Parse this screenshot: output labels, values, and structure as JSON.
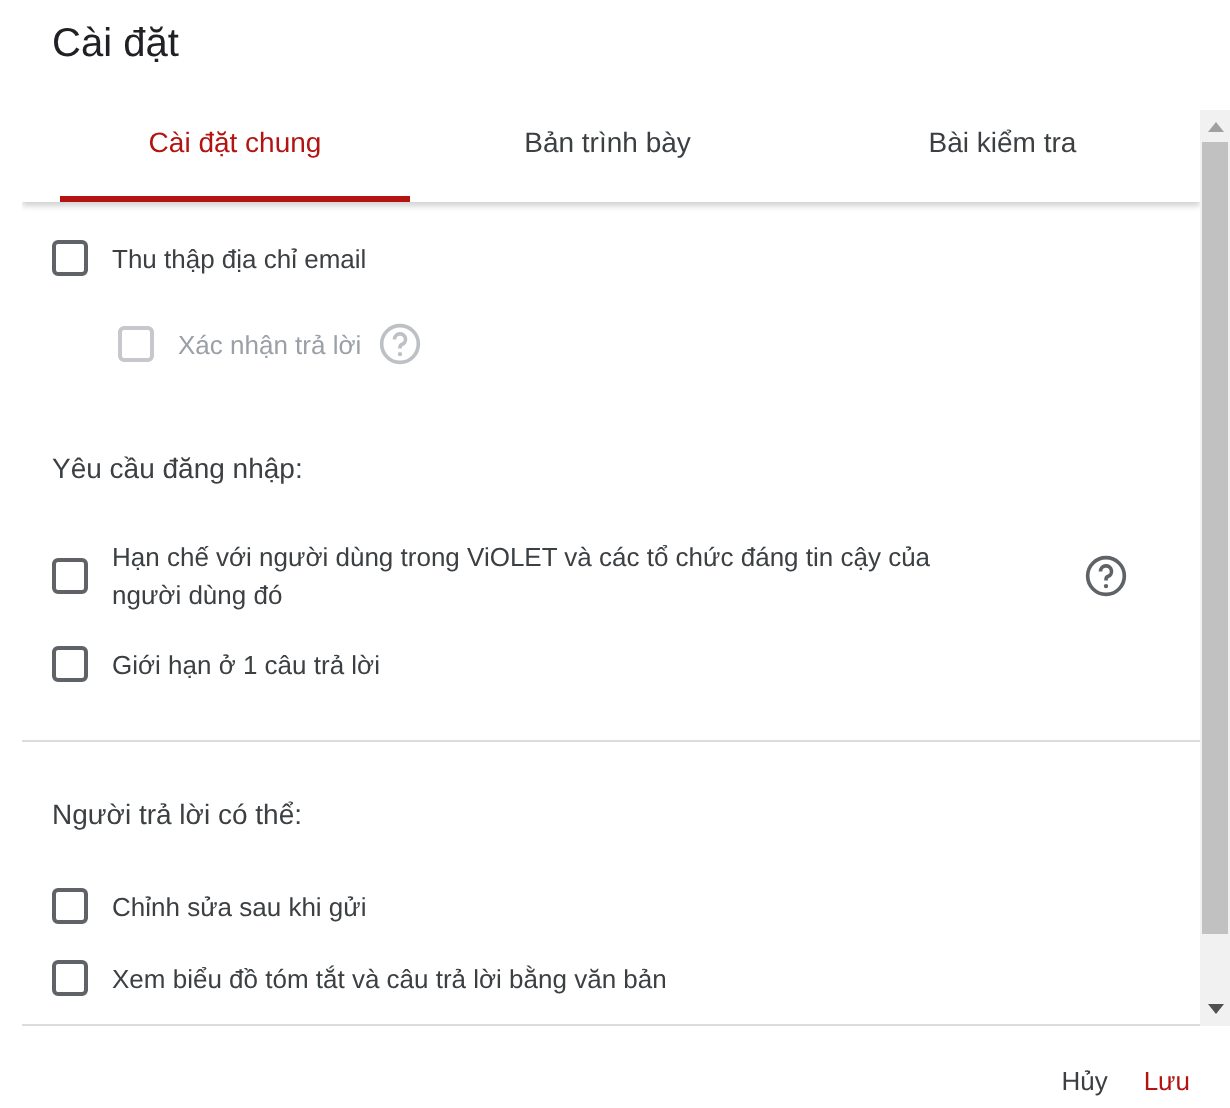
{
  "title": "Cài đặt",
  "tabs": [
    {
      "label": "Cài đặt chung",
      "selected": true
    },
    {
      "label": "Bản trình bày",
      "selected": false
    },
    {
      "label": "Bài kiểm tra",
      "selected": false
    }
  ],
  "items": [
    {
      "kind": "checkbox",
      "label": "Thu thập địa chỉ email",
      "checked": false,
      "disabled": false,
      "help": false,
      "children": [
        {
          "label": "Xác nhận trả lời",
          "checked": false,
          "disabled": true,
          "help": true
        }
      ]
    },
    {
      "kind": "heading",
      "label": "Yêu cầu đăng nhập:"
    },
    {
      "kind": "checkbox",
      "label": "Hạn chế với người dùng trong ViOLET và các tổ chức đáng tin cậy của người dùng đó",
      "checked": false,
      "disabled": false,
      "help": true
    },
    {
      "kind": "checkbox",
      "label": "Giới hạn ở 1 câu trả lời",
      "checked": false,
      "disabled": false,
      "help": false
    },
    {
      "kind": "divider"
    },
    {
      "kind": "heading",
      "label": "Người trả lời có thể:"
    },
    {
      "kind": "checkbox",
      "label": "Chỉnh sửa sau khi gửi",
      "checked": false,
      "disabled": false,
      "help": false
    },
    {
      "kind": "checkbox",
      "label": "Xem biểu đồ tóm tắt và câu trả lời bằng văn bản",
      "checked": false,
      "disabled": false,
      "help": false
    }
  ],
  "buttons": [
    {
      "label": "Hủy",
      "kind": "cancel"
    },
    {
      "label": "Lưu",
      "kind": "primary"
    }
  ]
}
